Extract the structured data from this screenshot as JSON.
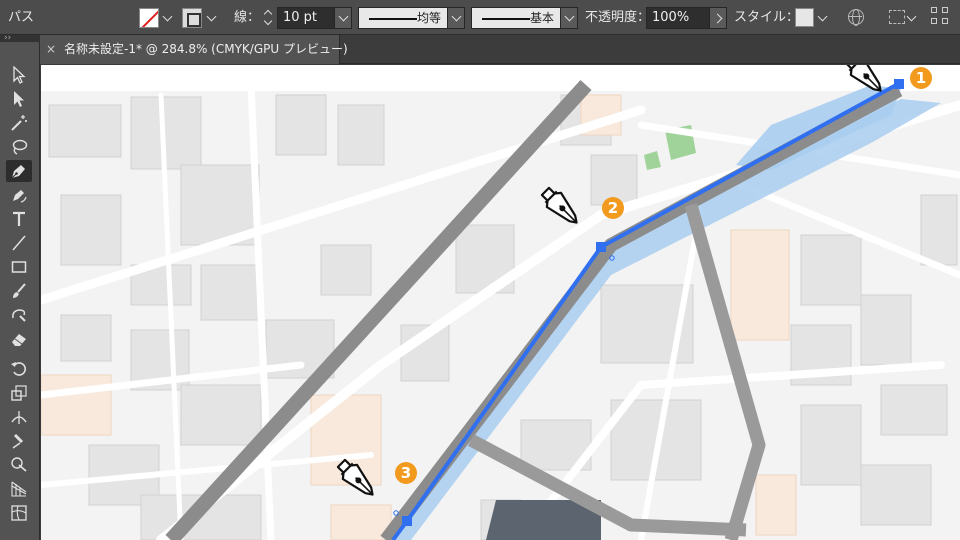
{
  "control_bar": {
    "selection_label": "パス",
    "stroke_label": "線：",
    "stroke_weight": "10 pt",
    "variable_width_label": "均等",
    "brush_label": "基本",
    "opacity_label": "不透明度：",
    "opacity_value": "100%",
    "style_label": "スタイル："
  },
  "document_tab": {
    "close_glyph": "×",
    "title": "名称未設定-1* @ 284.8% (CMYK/GPU プレビュー)"
  },
  "tools": [
    {
      "name": "selection-tool",
      "active": false
    },
    {
      "name": "direct-selection-tool",
      "active": false
    },
    {
      "name": "magic-wand-tool",
      "active": false
    },
    {
      "name": "lasso-tool",
      "active": false
    },
    {
      "name": "pen-tool",
      "active": true
    },
    {
      "name": "curvature-tool",
      "active": false
    },
    {
      "name": "type-tool",
      "active": false
    },
    {
      "name": "line-segment-tool",
      "active": false
    },
    {
      "name": "rectangle-tool",
      "active": false
    },
    {
      "name": "paintbrush-tool",
      "active": false
    },
    {
      "name": "shaper-tool",
      "active": false
    },
    {
      "name": "eraser-tool",
      "active": false
    },
    {
      "name": "rotate-tool",
      "active": false
    },
    {
      "name": "scale-tool",
      "active": false
    },
    {
      "name": "width-tool",
      "active": false
    },
    {
      "name": "puppet-warp-tool",
      "active": false
    },
    {
      "name": "shape-builder-tool",
      "active": false
    },
    {
      "name": "perspective-grid-tool",
      "active": false
    },
    {
      "name": "mesh-tool",
      "active": false
    }
  ],
  "annotations": {
    "step1": "1",
    "step2": "2",
    "step3": "3"
  },
  "colors": {
    "path_stroke": "#2f6ff0",
    "path_highlight": "#a8cdef",
    "badge": "#f29a1d",
    "railway": "#8c8c8c",
    "road_gray": "#9a9a9a"
  }
}
